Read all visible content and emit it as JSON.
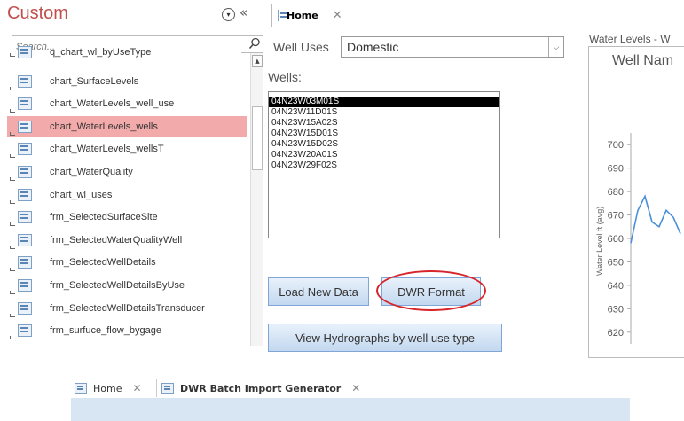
{
  "nav": {
    "title": "Custom",
    "search_placeholder": "Search...",
    "items": [
      {
        "label": "q_chart_wl_byUseType",
        "selected": false
      },
      {
        "label": "chart_SurfaceLevels",
        "selected": false
      },
      {
        "label": "chart_WaterLevels_well_use",
        "selected": false
      },
      {
        "label": "chart_WaterLevels_wells",
        "selected": true
      },
      {
        "label": "chart_WaterLevels_wellsT",
        "selected": false
      },
      {
        "label": "chart_WaterQuality",
        "selected": false
      },
      {
        "label": "chart_wl_uses",
        "selected": false
      },
      {
        "label": "frm_SelectedSurfaceSite",
        "selected": false
      },
      {
        "label": "frm_SelectedWaterQualityWell",
        "selected": false
      },
      {
        "label": "frm_SelectedWellDetails",
        "selected": false
      },
      {
        "label": "frm_SelectedWellDetailsByUse",
        "selected": false
      },
      {
        "label": "frm_SelectedWellDetailsTransducer",
        "selected": false
      },
      {
        "label": "frm_surfuce_flow_bygage",
        "selected": false
      }
    ]
  },
  "tabs": {
    "home": "Home",
    "batch": "DWR Batch Import Generator"
  },
  "form": {
    "well_uses_label": "Well Uses",
    "well_uses_value": "Domestic",
    "wells_label": "Wells:",
    "wells": [
      {
        "id": "04N23W03M01S",
        "selected": true
      },
      {
        "id": "04N23W11D01S",
        "selected": false
      },
      {
        "id": "04N23W15A02S",
        "selected": false
      },
      {
        "id": "04N23W15D01S",
        "selected": false
      },
      {
        "id": "04N23W15D02S",
        "selected": false
      },
      {
        "id": "04N23W20A01S",
        "selected": false
      },
      {
        "id": "04N23W29F02S",
        "selected": false
      }
    ],
    "load_button": "Load New Data",
    "dwr_button": "DWR Format",
    "hydro_button": "View Hydrographs by  well use type"
  },
  "chart_data": {
    "type": "line",
    "caption": "Water Levels - W",
    "title": "Well Nam",
    "ylabel": "Water Level ft (avg)",
    "yticks": [
      620,
      630,
      640,
      650,
      660,
      670,
      680,
      690,
      700
    ],
    "ylim": [
      615,
      705
    ],
    "series": [
      {
        "x": [
          0,
          1,
          2,
          3,
          4,
          5,
          6,
          7
        ],
        "values": [
          658,
          672,
          678,
          667,
          665,
          672,
          669,
          662
        ]
      }
    ],
    "line_color": "#4a90d9"
  },
  "colors": {
    "nav_title": "#c0504d",
    "selected_row": "#f2aaaa",
    "highlight_ring": "#d7262b"
  }
}
